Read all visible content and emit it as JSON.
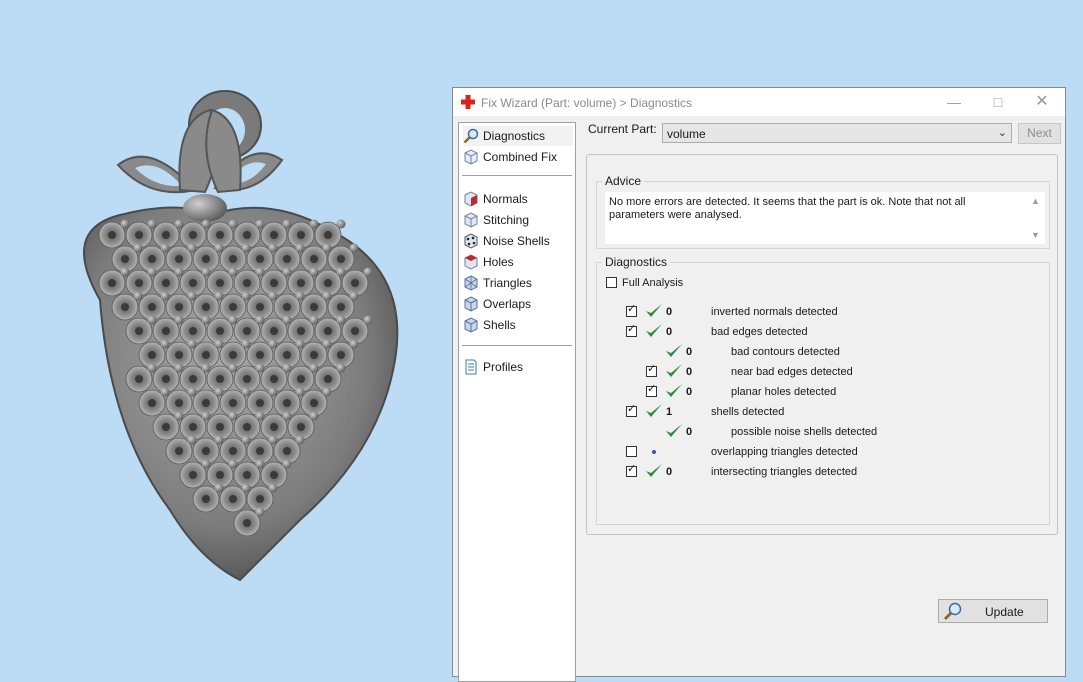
{
  "window": {
    "title": "Fix Wizard (Part: volume) > Diagnostics",
    "minimize_icon": "minimize-icon",
    "maximize_icon": "maximize-icon",
    "close_icon": "close-icon"
  },
  "nav": {
    "top": [
      {
        "label": "Diagnostics",
        "icon": "magnifier-icon",
        "selected": true
      },
      {
        "label": "Combined Fix",
        "icon": "cube-icon"
      }
    ],
    "steps": [
      {
        "label": "Normals",
        "icon": "normals-cube-icon"
      },
      {
        "label": "Stitching",
        "icon": "stitching-cube-icon"
      },
      {
        "label": "Noise Shells",
        "icon": "noise-shells-icon"
      },
      {
        "label": "Holes",
        "icon": "holes-cube-icon"
      },
      {
        "label": "Triangles",
        "icon": "triangles-cube-icon"
      },
      {
        "label": "Overlaps",
        "icon": "overlaps-cube-icon"
      },
      {
        "label": "Shells",
        "icon": "shells-cube-icon"
      }
    ],
    "bottom": [
      {
        "label": "Profiles",
        "icon": "document-icon"
      }
    ]
  },
  "current_part": {
    "label": "Current Part:",
    "value": "volume"
  },
  "next_label": "Next",
  "advice": {
    "title": "Advice",
    "text": "No more errors are detected. It seems that the part is ok. Note that not all parameters were analysed."
  },
  "diagnostics": {
    "title": "Diagnostics",
    "full_analysis_label": "Full Analysis",
    "full_analysis_checked": false,
    "rows": [
      {
        "label": "inverted normals detected",
        "count": "0",
        "checked": true,
        "status": "ok",
        "indent": false,
        "has_checkbox": true
      },
      {
        "label": "bad edges detected",
        "count": "0",
        "checked": true,
        "status": "ok",
        "indent": false,
        "has_checkbox": true
      },
      {
        "label": "bad contours detected",
        "count": "0",
        "checked": false,
        "status": "ok",
        "indent": true,
        "has_checkbox": false
      },
      {
        "label": "near bad edges detected",
        "count": "0",
        "checked": true,
        "status": "ok",
        "indent": true,
        "has_checkbox": true
      },
      {
        "label": "planar holes detected",
        "count": "0",
        "checked": true,
        "status": "ok",
        "indent": true,
        "has_checkbox": true
      },
      {
        "label": "shells detected",
        "count": "1",
        "checked": true,
        "status": "ok",
        "indent": false,
        "has_checkbox": true
      },
      {
        "label": "possible noise shells detected",
        "count": "0",
        "checked": false,
        "status": "ok",
        "indent": true,
        "has_checkbox": false
      },
      {
        "label": "overlapping triangles detected",
        "count": "",
        "checked": false,
        "status": "not-analysed",
        "indent": false,
        "has_checkbox": true
      },
      {
        "label": "intersecting triangles detected",
        "count": "0",
        "checked": true,
        "status": "ok",
        "indent": false,
        "has_checkbox": true
      }
    ],
    "update_label": "Update"
  },
  "colors": {
    "background": "#bcdcf5",
    "check_green": "#2e8b3a",
    "model_gray": "#8c8c8c"
  }
}
